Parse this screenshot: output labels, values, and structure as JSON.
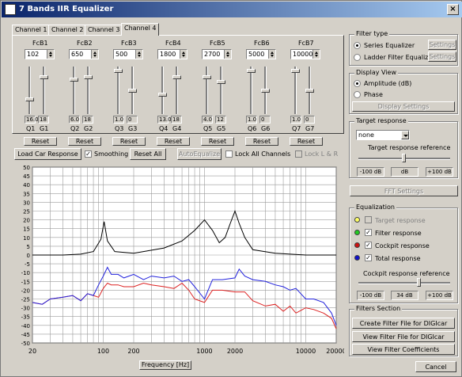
{
  "window": {
    "title": "7 Bands IIR Equalizer",
    "close_label": "×"
  },
  "tabs": [
    "Channel 1",
    "Channel 2",
    "Channel 3",
    "Channel 4"
  ],
  "active_tab": 3,
  "bands": [
    {
      "fc_label": "FcB1",
      "fc": "102",
      "q": "16.0",
      "g": "18",
      "q_label": "Q1",
      "g_label": "G1",
      "q_level": 0.7,
      "g_level": 0.2
    },
    {
      "fc_label": "FcB2",
      "fc": "650",
      "q": "6.0",
      "g": "18",
      "q_label": "Q2",
      "g_label": "G2",
      "q_level": 0.25,
      "g_level": 0.2
    },
    {
      "fc_label": "FcB3",
      "fc": "500",
      "q": "1.0",
      "g": "0",
      "q_label": "Q3",
      "g_label": "G3",
      "q_level": 0.05,
      "g_level": 0.5
    },
    {
      "fc_label": "FcB4",
      "fc": "1800",
      "q": "13.0",
      "g": "18",
      "q_label": "Q4",
      "g_label": "G4",
      "q_level": 0.6,
      "g_level": 0.2
    },
    {
      "fc_label": "FcB5",
      "fc": "2700",
      "q": "4.0",
      "g": "12",
      "q_label": "Q5",
      "g_label": "G5",
      "q_level": 0.2,
      "g_level": 0.3
    },
    {
      "fc_label": "FcB6",
      "fc": "5000",
      "q": "1.0",
      "g": "0",
      "q_label": "Q6",
      "g_label": "G6",
      "q_level": 0.05,
      "g_level": 0.5
    },
    {
      "fc_label": "FcB7",
      "fc": "10000",
      "q": "1.0",
      "g": "0",
      "q_label": "Q7",
      "g_label": "G7",
      "q_level": 0.05,
      "g_level": 0.5
    }
  ],
  "reset_label": "Reset",
  "toolbar": {
    "load_car": "Load Car Response",
    "smoothing": "Smoothing",
    "reset_all": "Reset All",
    "auto_equalize": "AutoEqualize",
    "lock_all": "Lock All Channels",
    "lock_lr": "Lock L & R"
  },
  "filter_type": {
    "title": "Filter type",
    "series": "Series Equalizer",
    "ladder": "Ladder Filter Equalizer",
    "settings": "Settings"
  },
  "display_view": {
    "title": "Display View",
    "amplitude": "Amplitude (dB)",
    "phase": "Phase",
    "display_settings": "Display Settings"
  },
  "target": {
    "title": "Target response",
    "select_value": "none",
    "ref_label": "Target response reference",
    "min": "-100 dB",
    "unit": "dB",
    "max": "+100 dB",
    "level": 0.5
  },
  "fft_settings": "FFT Settings",
  "equalization": {
    "title": "Equalization",
    "items": [
      {
        "label": "Target response",
        "color": "#ffff66",
        "checked": false,
        "disabled": true
      },
      {
        "label": "Filter response",
        "color": "#22cc22",
        "checked": true,
        "disabled": false
      },
      {
        "label": "Cockpit response",
        "color": "#cc1111",
        "checked": true,
        "disabled": false
      },
      {
        "label": "Total response",
        "color": "#1111cc",
        "checked": true,
        "disabled": false
      }
    ],
    "ref_label": "Cockpit response reference",
    "min": "-100 dB",
    "value": "34 dB",
    "max": "+100 dB",
    "level": 0.67
  },
  "filters_section": {
    "title": "Filters Section",
    "create": "Create Filter File for DIGIcar",
    "view_file": "View Filter File for DIGIcar",
    "view_coeff": "View Filter Coefficients"
  },
  "cancel": "Cancel",
  "chart_data": {
    "type": "line",
    "xlabel": "Frequency [Hz]",
    "ylabel": "",
    "xscale": "log",
    "xlim": [
      20,
      20000
    ],
    "ylim": [
      -50,
      50
    ],
    "xticks": [
      "20",
      "100",
      "200",
      "1000",
      "2000",
      "10000",
      "20000"
    ],
    "yticks": [
      "50",
      "45",
      "40",
      "35",
      "30",
      "25",
      "20",
      "15",
      "10",
      "5",
      "0",
      "-5",
      "-10",
      "-15",
      "-20",
      "-25",
      "-30",
      "-35",
      "-40",
      "-45",
      "-50"
    ],
    "grid": true,
    "series": [
      {
        "color": "#000000",
        "x": [
          20,
          40,
          60,
          80,
          95,
          102,
          110,
          130,
          200,
          400,
          600,
          800,
          1000,
          1200,
          1400,
          1600,
          1800,
          2000,
          2200,
          2500,
          3000,
          5000,
          10000,
          20000
        ],
        "y": [
          0,
          0,
          0.5,
          2,
          9,
          19,
          8,
          2,
          1,
          4,
          8,
          14,
          20,
          14,
          7,
          10,
          18,
          25,
          18,
          10,
          3,
          1,
          0,
          0
        ]
      },
      {
        "color": "#dd2222",
        "x": [
          20,
          25,
          30,
          40,
          50,
          60,
          70,
          80,
          90,
          100,
          110,
          120,
          140,
          160,
          200,
          250,
          300,
          400,
          500,
          600,
          700,
          800,
          1000,
          1200,
          1500,
          2000,
          2500,
          3000,
          4000,
          5000,
          6000,
          7000,
          8000,
          10000,
          12000,
          15000,
          18000,
          20000
        ],
        "y": [
          -27,
          -28,
          -25,
          -24,
          -23,
          -26,
          -22,
          -23,
          -24,
          -19,
          -16,
          -17,
          -17,
          -18,
          -18,
          -16,
          -17,
          -18,
          -19,
          -16,
          -20,
          -25,
          -27,
          -20,
          -20,
          -21,
          -21,
          -26,
          -29,
          -28,
          -32,
          -29,
          -33,
          -30,
          -31,
          -33,
          -36,
          -42
        ]
      },
      {
        "color": "#2222dd",
        "x": [
          20,
          25,
          30,
          40,
          50,
          60,
          70,
          80,
          90,
          100,
          110,
          120,
          140,
          160,
          200,
          250,
          300,
          400,
          500,
          600,
          700,
          800,
          1000,
          1200,
          1500,
          2000,
          2200,
          2500,
          3000,
          4000,
          5000,
          6000,
          7000,
          8000,
          10000,
          12000,
          15000,
          18000,
          20000
        ],
        "y": [
          -27,
          -28,
          -25,
          -24,
          -23,
          -26,
          -22,
          -23,
          -17,
          -12,
          -7,
          -11,
          -11,
          -13,
          -11,
          -14,
          -12,
          -13,
          -12,
          -15,
          -14,
          -18,
          -25,
          -14,
          -14,
          -13,
          -8,
          -12,
          -14,
          -15,
          -17,
          -18,
          -20,
          -19,
          -25,
          -25,
          -27,
          -33,
          -40
        ]
      }
    ]
  }
}
